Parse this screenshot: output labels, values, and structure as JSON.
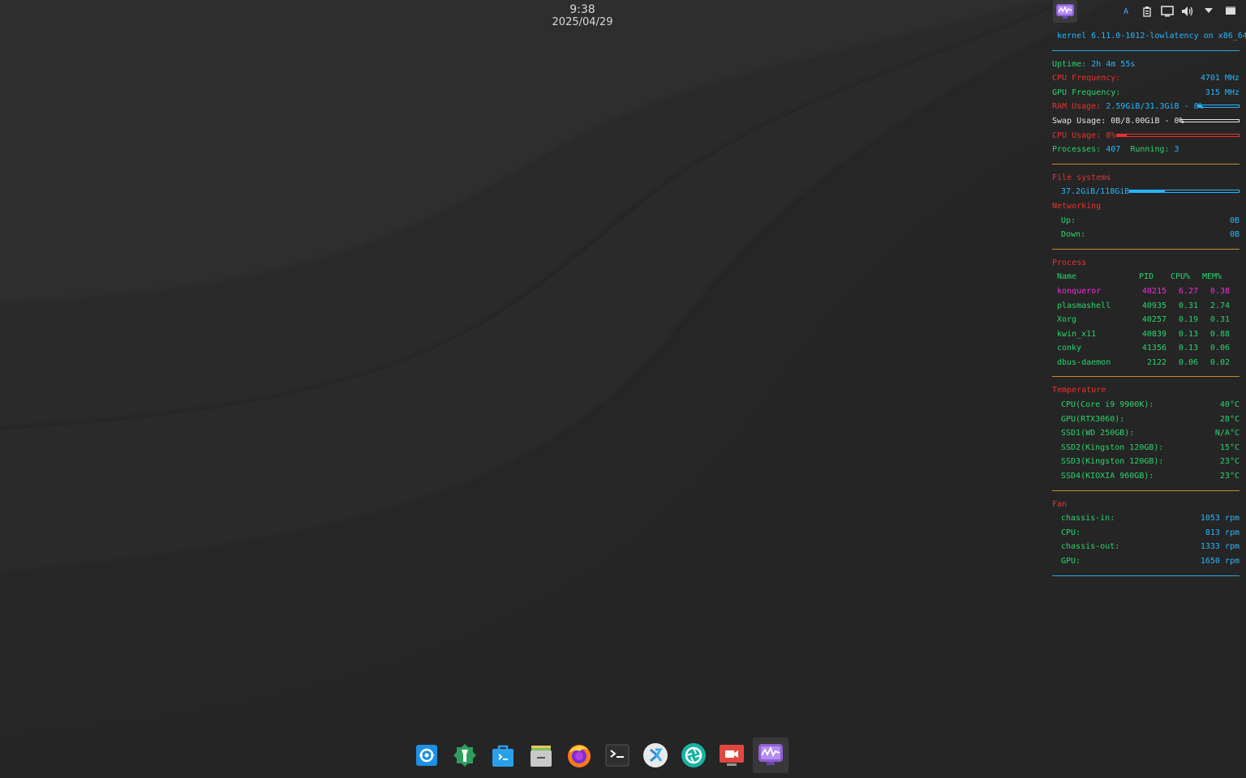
{
  "clock": {
    "time": "9:38",
    "date": "2025/04/29"
  },
  "tray": {
    "icons": [
      "system-monitor-icon",
      "keyboard-layout-icon",
      "clipboard-icon",
      "display-icon",
      "volume-icon",
      "expand-arrow-icon",
      "show-desktop-icon"
    ],
    "keyboard_label": "A"
  },
  "conky": {
    "kernel": "kernel 6.11.0-1012-lowlatency on x86_64",
    "uptime_label": "Uptime:",
    "uptime": "2h 4m 55s",
    "cpu_freq_label": "CPU Frequency:",
    "cpu_freq": "4701 MHz",
    "gpu_freq_label": "GPU Frequency:",
    "gpu_freq": "315 MHz",
    "ram_label": "RAM Usage:",
    "ram": "2.59GiB/31.3GiB - 8%",
    "ram_fraction": 0.08,
    "swap_label": "Swap Usage:",
    "swap": "0B/8.00GiB - 0%",
    "swap_fraction": 0.0,
    "cpu_usage_label": "CPU Usage:",
    "cpu_usage": "8%",
    "cpu_fraction": 0.08,
    "processes_label": "Processes:",
    "processes": "407",
    "running_label": "Running:",
    "running": "3",
    "filesystems_title": "File systems",
    "fs": "37.2GiB/118GiB",
    "fs_fraction": 0.32,
    "networking_title": "Networking",
    "up_label": "Up:",
    "up": "0B",
    "down_label": "Down:",
    "down": "0B",
    "process_title": "Process",
    "proc_headers": {
      "name": "Name",
      "pid": "PID",
      "cpu": "CPU%",
      "mem": "MEM%"
    },
    "processes_list": [
      {
        "name": "konqueror",
        "pid": "40215",
        "cpu": "6.27",
        "mem": "0.38"
      },
      {
        "name": "plasmashell",
        "pid": "40935",
        "cpu": "0.31",
        "mem": "2.74"
      },
      {
        "name": "Xorg",
        "pid": "40257",
        "cpu": "0.19",
        "mem": "0.31"
      },
      {
        "name": "kwin_x11",
        "pid": "40839",
        "cpu": "0.13",
        "mem": "0.88"
      },
      {
        "name": "conky",
        "pid": "41356",
        "cpu": "0.13",
        "mem": "0.06"
      },
      {
        "name": "dbus-daemon",
        "pid": "2122",
        "cpu": "0.06",
        "mem": "0.02"
      }
    ],
    "temperature_title": "Temperature",
    "temps": [
      {
        "label": "CPU(Core i9 9900K):",
        "value": "40°C"
      },
      {
        "label": "GPU(RTX3060):",
        "value": "28°C"
      },
      {
        "label": "SSD1(WD 250GB):",
        "value": "N/A°C"
      },
      {
        "label": "SSD2(Kingston 120GB):",
        "value": "15°C"
      },
      {
        "label": "SSD3(Kingston 120GB):",
        "value": "23°C"
      },
      {
        "label": "SSD4(KIOXIA 960GB):",
        "value": "23°C"
      }
    ],
    "fan_title": "Fan",
    "fans": [
      {
        "label": "chassis-in:",
        "value": "1053 rpm"
      },
      {
        "label": "CPU:",
        "value": "813 rpm"
      },
      {
        "label": "chassis-out:",
        "value": "1333 rpm"
      },
      {
        "label": "GPU:",
        "value": "1650 rpm"
      }
    ],
    "colors": {
      "red": "#e8322f",
      "green": "#2bd46c",
      "blue": "#27b6ff",
      "magenta": "#ee2fd7",
      "white": "#e6e6e6",
      "sep_blue": "#2aa6e0",
      "sep_orange": "#c88a2b"
    }
  },
  "dock": {
    "items": [
      "settings-icon",
      "system-tools-icon",
      "discover-store-icon",
      "file-manager-icon",
      "firefox-icon",
      "terminal-icon",
      "kdeconnect-icon",
      "screenshot-icon",
      "screen-recorder-icon",
      "system-monitor-icon"
    ],
    "active_index": 9
  }
}
